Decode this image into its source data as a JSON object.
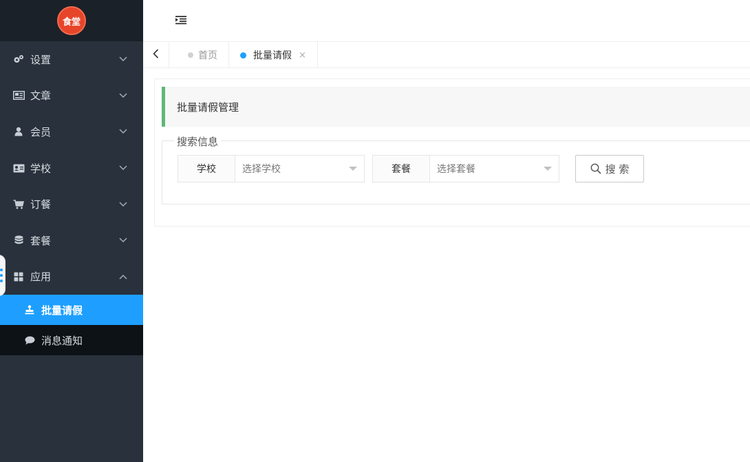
{
  "logo": {
    "text": "食堂"
  },
  "sidebar": {
    "items": [
      {
        "label": "设置",
        "icon": "gears-icon",
        "expanded": false
      },
      {
        "label": "文章",
        "icon": "newspaper-icon",
        "expanded": false
      },
      {
        "label": "会员",
        "icon": "user-icon",
        "expanded": false
      },
      {
        "label": "学校",
        "icon": "id-card-icon",
        "expanded": false
      },
      {
        "label": "订餐",
        "icon": "cart-icon",
        "expanded": false
      },
      {
        "label": "套餐",
        "icon": "database-icon",
        "expanded": false
      },
      {
        "label": "应用",
        "icon": "grid-icon",
        "expanded": true
      }
    ],
    "subitems": [
      {
        "label": "批量请假",
        "icon": "stamp-icon",
        "active": true
      },
      {
        "label": "消息通知",
        "icon": "chat-icon",
        "active": false
      }
    ]
  },
  "header": {
    "fold_icon": "menu-fold-icon"
  },
  "tabs": [
    {
      "label": "首页",
      "active": false
    },
    {
      "label": "批量请假",
      "active": true,
      "close": "×"
    }
  ],
  "main": {
    "quote_title": "批量请假管理",
    "search": {
      "legend": "搜索信息",
      "fields": [
        {
          "label": "学校",
          "placeholder": "选择学校"
        },
        {
          "label": "套餐",
          "placeholder": "选择套餐"
        }
      ],
      "button_label": "搜 索"
    }
  },
  "colors": {
    "sidebar_bg": "#28313c",
    "submenu_bg": "#0d1217",
    "active_blue": "#1e9fff",
    "quote_green": "#5fb878",
    "logo_red": "#e7452a"
  }
}
